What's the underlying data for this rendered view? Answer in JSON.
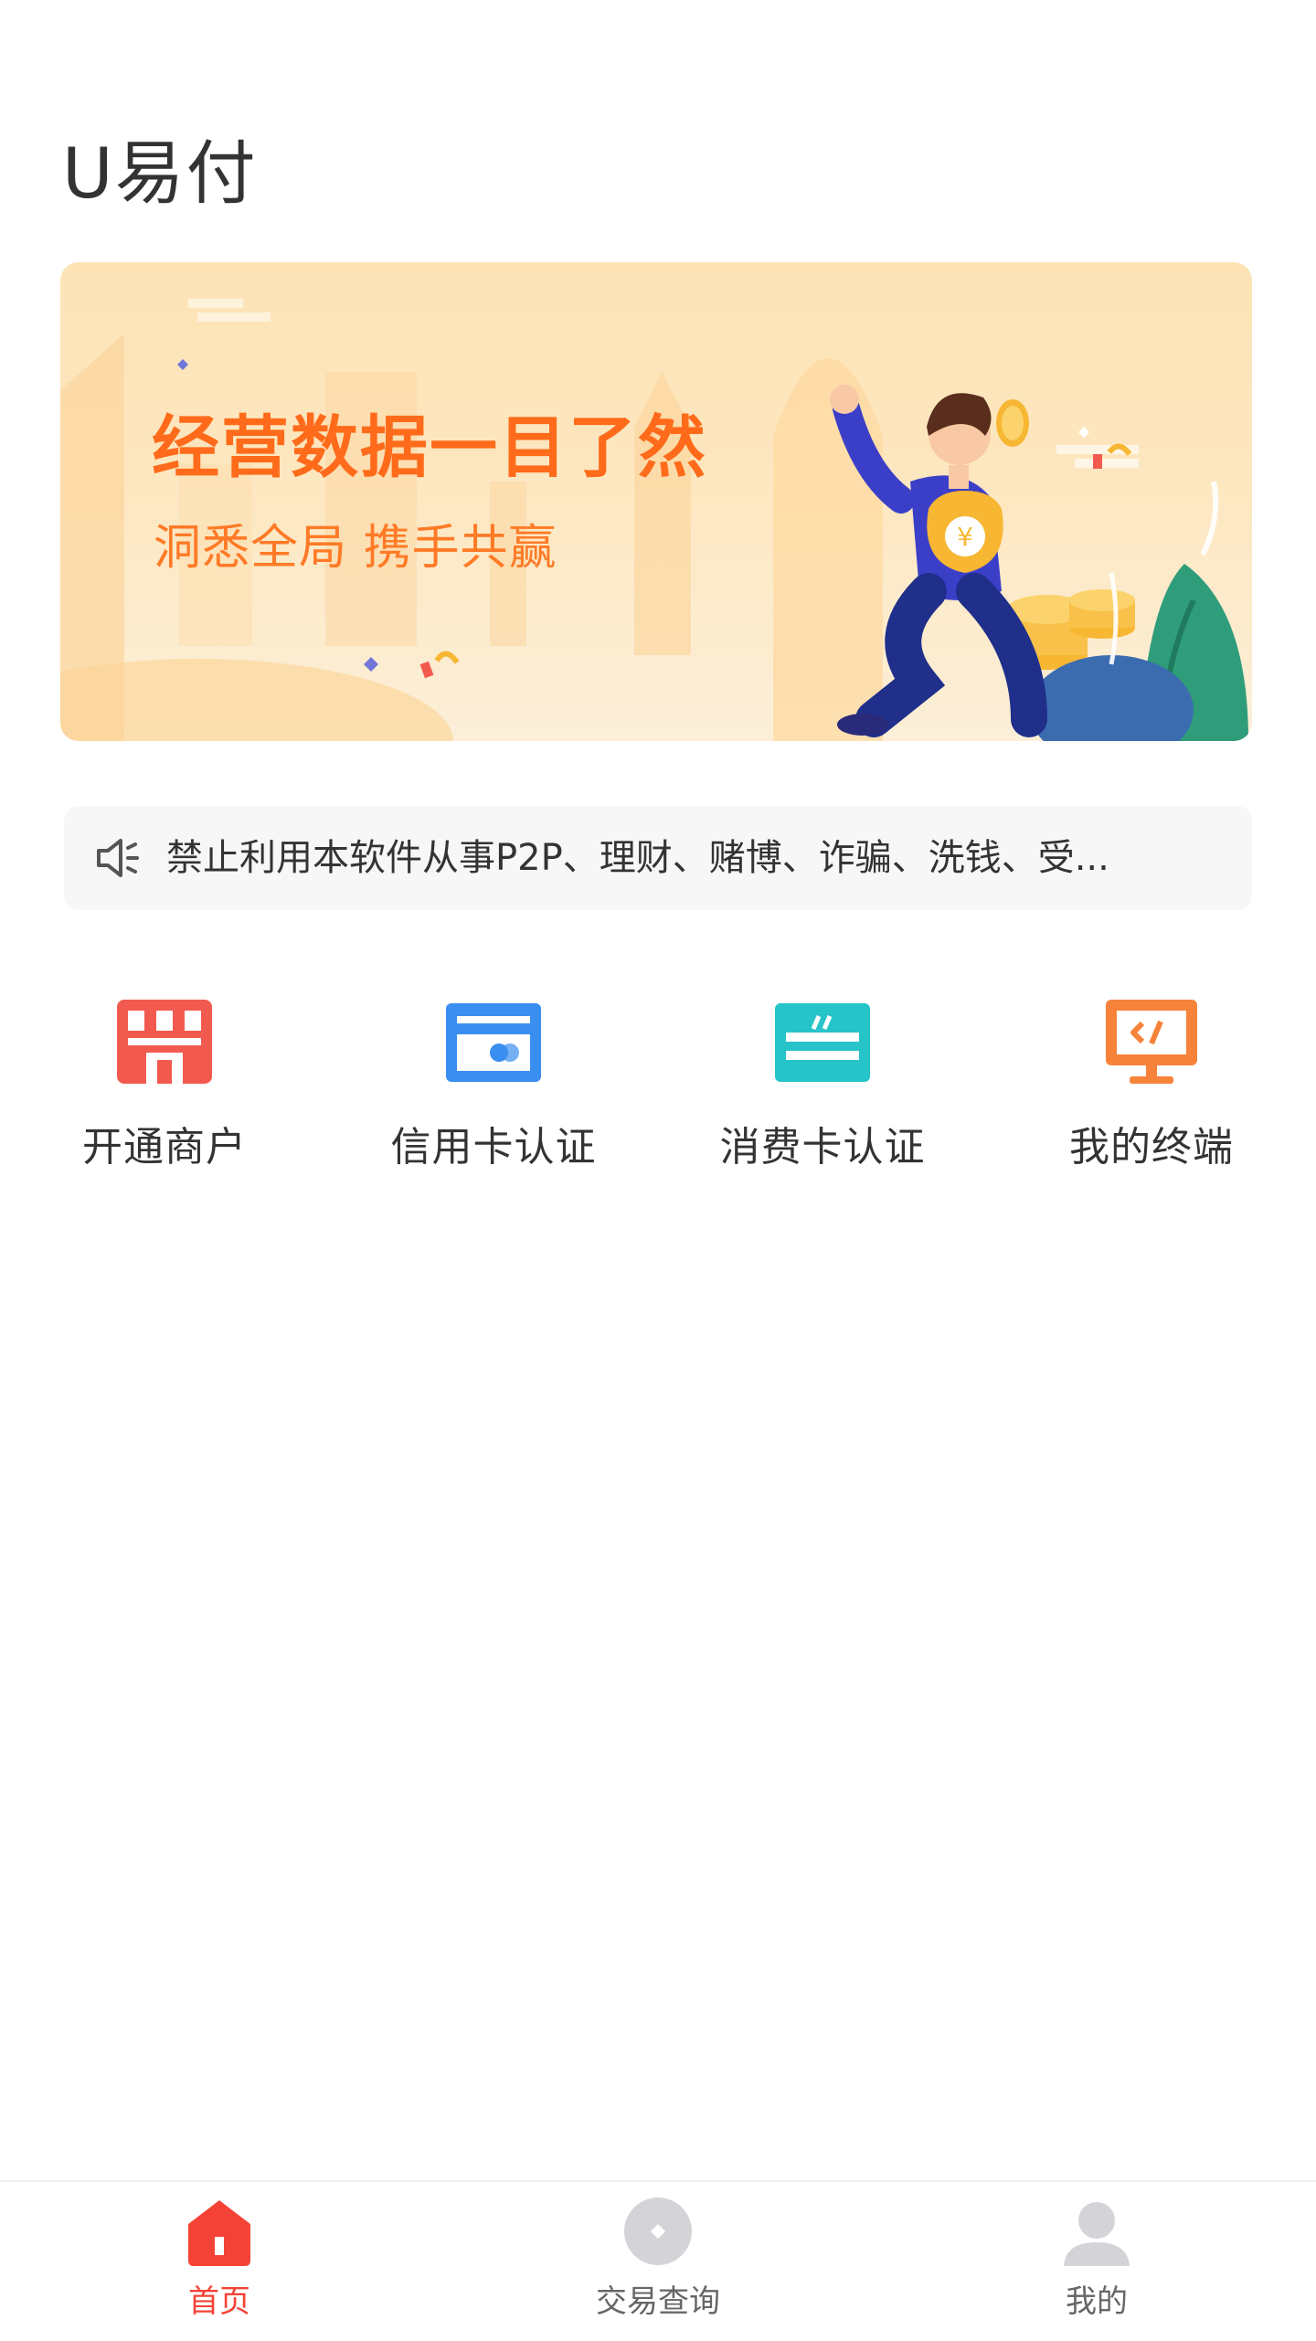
{
  "app": {
    "title": "U易付"
  },
  "banner": {
    "headline": "经营数据一目了然",
    "subheadline": "洞悉全局 携手共赢",
    "colors": {
      "background": "#fde4b8",
      "headline": "#ff6b1a"
    }
  },
  "notice": {
    "icon": "speaker-icon",
    "text": "禁止利用本软件从事P2P、理财、赌博、诈骗、洗钱、受..."
  },
  "menu": {
    "items": [
      {
        "label": "开通商户",
        "icon": "store-icon",
        "color": "#f25a4f"
      },
      {
        "label": "信用卡认证",
        "icon": "credit-card-icon",
        "color": "#3a8ef0"
      },
      {
        "label": "消费卡认证",
        "icon": "consumer-card-icon",
        "color": "#26c4c9"
      },
      {
        "label": "我的终端",
        "icon": "terminal-icon",
        "color": "#f7823a"
      }
    ]
  },
  "tabbar": {
    "tabs": [
      {
        "label": "首页",
        "icon": "home-icon",
        "active": true
      },
      {
        "label": "交易查询",
        "icon": "transaction-query-icon",
        "active": false
      },
      {
        "label": "我的",
        "icon": "profile-icon",
        "active": false
      }
    ],
    "colors": {
      "active": "#f44336",
      "inactive": "#666666",
      "inactive_icon": "#d4d4d8"
    }
  }
}
